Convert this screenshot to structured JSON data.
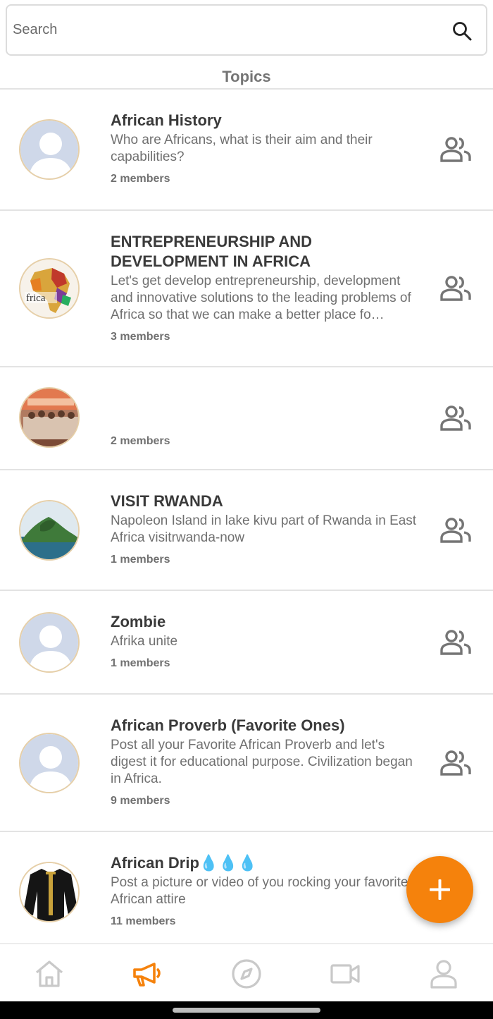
{
  "search": {
    "placeholder": "Search"
  },
  "section": {
    "title": "Topics"
  },
  "topics": [
    {
      "title": "African History",
      "description": "Who are Africans,  what is their aim and their capabilities?",
      "members": "2 members",
      "avatar": "default"
    },
    {
      "title": "ENTREPRENEURSHIP AND DEVELOPMENT IN AFRICA",
      "description": "Let's get develop entrepreneurship, development and innovative solutions to the leading problems of Africa so that we can make a better place fo…",
      "members": "3 members",
      "avatar": "africa-map",
      "avatar_text": "frica"
    },
    {
      "title": "",
      "description": "",
      "members": "2 members",
      "avatar": "group-photo"
    },
    {
      "title": "VISIT RWANDA",
      "description": "Napoleon Island in lake kivu part of Rwanda in East Africa visitrwanda-now",
      "members": "1 members",
      "avatar": "island"
    },
    {
      "title": "Zombie",
      "description": "Afrika unite",
      "members": "1 members",
      "avatar": "default"
    },
    {
      "title": "African Proverb (Favorite Ones)",
      "description": "Post all your Favorite African Proverb and let's digest it for educational purpose. Civilization began in Africa.",
      "members": "9 members",
      "avatar": "default"
    },
    {
      "title": "African Drip💧💧💧",
      "description": "Post a picture or video of you rocking your favorite African attire",
      "members": "11 members",
      "avatar": "attire"
    }
  ],
  "nav": [
    {
      "icon": "home-icon",
      "active": false
    },
    {
      "icon": "megaphone-icon",
      "active": true
    },
    {
      "icon": "compass-icon",
      "active": false
    },
    {
      "icon": "video-camera-icon",
      "active": false
    },
    {
      "icon": "profile-icon",
      "active": false
    }
  ],
  "fab": {
    "icon": "plus-icon"
  },
  "colors": {
    "accent": "#f5820c",
    "inactive_icon": "#c9c9c9",
    "members_icon": "#757575",
    "default_avatar_bg": "#cfd8e9"
  }
}
